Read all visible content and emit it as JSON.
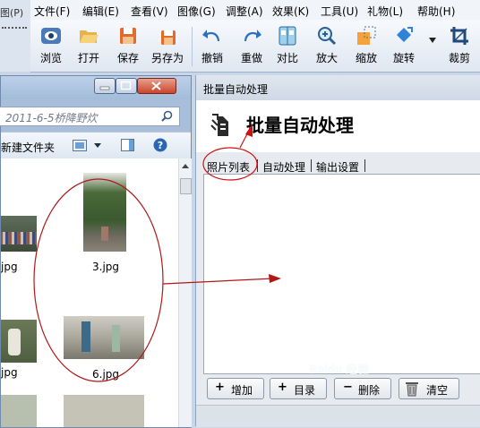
{
  "menubar": {
    "left_clip": "图(",
    "left_clip_key": "P)",
    "items": [
      {
        "label": "文件(F)"
      },
      {
        "label": "编辑(E)"
      },
      {
        "label": "查看(V)"
      },
      {
        "label": "图像(G)"
      },
      {
        "label": "调整(A)"
      },
      {
        "label": "效果(K)"
      },
      {
        "label": "工具(U)"
      },
      {
        "label": "礼物(L)"
      },
      {
        "label": "帮助(H)"
      }
    ]
  },
  "toolbar": {
    "buttons": [
      {
        "label": "浏览",
        "icon": "eye-icon"
      },
      {
        "label": "打开",
        "icon": "folder-open-icon"
      },
      {
        "label": "保存",
        "icon": "floppy-icon"
      },
      {
        "label": "另存为",
        "icon": "save-as-icon"
      },
      {
        "label": "撤销",
        "icon": "undo-icon"
      },
      {
        "label": "重做",
        "icon": "redo-icon"
      },
      {
        "label": "对比",
        "icon": "compare-icon"
      },
      {
        "label": "放大",
        "icon": "zoom-in-icon"
      },
      {
        "label": "缩放",
        "icon": "resize-icon"
      },
      {
        "label": "旋转",
        "icon": "rotate-icon"
      },
      {
        "label": "裁剪",
        "icon": "crop-icon"
      }
    ]
  },
  "explorer": {
    "address_text": "2011-6-5桥降野炊",
    "new_folder_label": "新建文件夹",
    "files": [
      {
        "name": "jpg"
      },
      {
        "name": "3.jpg"
      },
      {
        "name": "jpg"
      },
      {
        "name": "6.jpg"
      }
    ]
  },
  "dialog": {
    "window_title": "批量自动处理",
    "heading": "批量自动处理",
    "tabs": [
      {
        "label": "照片列表"
      },
      {
        "label": "自动处理"
      },
      {
        "label": "输出设置"
      }
    ],
    "buttons": {
      "add": "增加",
      "folder": "目录",
      "delete": "删除",
      "clear": "清空"
    },
    "watermark": "Baidu 经验"
  },
  "colors": {
    "annotation_red": "#b01818",
    "selection_red": "#d01010"
  }
}
